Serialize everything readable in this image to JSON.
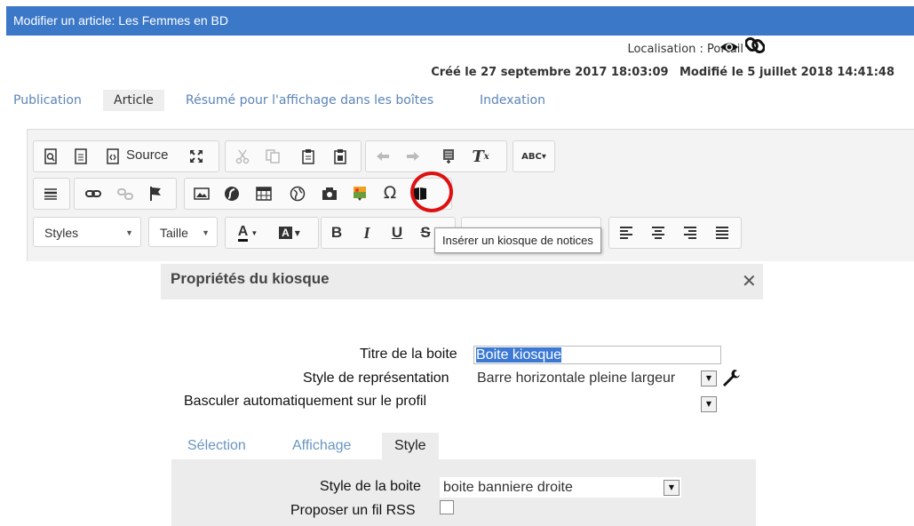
{
  "window": {
    "title": "Modifier un article: Les Femmes en BD"
  },
  "meta": {
    "location": "Localisation : Portail",
    "created": "Créé le 27 septembre 2017 18:03:09",
    "modified": "Modifié le 5 juillet 2018 14:41:48"
  },
  "tabs": [
    {
      "label": "Publication"
    },
    {
      "label": "Article"
    },
    {
      "label": "Résumé pour l'affichage dans les boîtes"
    },
    {
      "label": "Indexation"
    }
  ],
  "toolbar": {
    "source_label": "Source",
    "styles_label": "Styles",
    "size_label": "Taille",
    "bold": "B",
    "italic": "I",
    "underline": "U",
    "omega": "Ω",
    "tooltip": "Insérer un kiosque de notices"
  },
  "dialog": {
    "title": "Propriétés du kiosque",
    "close": "✕",
    "box_title_label": "Titre de la boite",
    "box_title_value": "Boite kiosque",
    "style_label": "Style de représentation",
    "style_value": "Barre horizontale pleine largeur",
    "profile_label": "Basculer automatiquement sur le profil",
    "subtabs": [
      {
        "label": "Sélection"
      },
      {
        "label": "Affichage"
      },
      {
        "label": "Style"
      }
    ],
    "box_style_label": "Style de la boite",
    "box_style_value": "boite banniere droite",
    "rss_label": "Proposer un fil RSS"
  },
  "colors": {
    "titlebar": "#3b78c8",
    "link": "#5b84b8",
    "highlight": "#3b79d4",
    "circle": "#dd1111"
  }
}
